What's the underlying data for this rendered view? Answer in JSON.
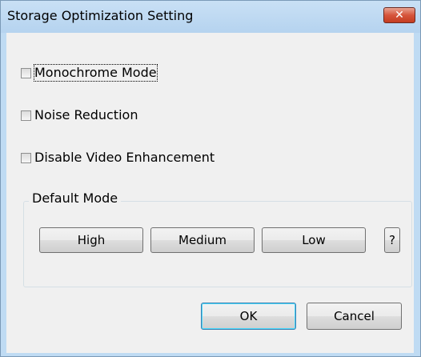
{
  "window": {
    "title": "Storage Optimization Setting",
    "close_glyph": "✕"
  },
  "options": [
    {
      "label": "Monochrome Mode",
      "checked": false,
      "focused": true
    },
    {
      "label": "Noise Reduction",
      "checked": false,
      "focused": false
    },
    {
      "label": "Disable Video Enhancement",
      "checked": false,
      "focused": false
    }
  ],
  "default_mode": {
    "group_label": "Default Mode",
    "buttons": [
      "High",
      "Medium",
      "Low"
    ],
    "help_label": "?"
  },
  "actions": {
    "ok_label": "OK",
    "cancel_label": "Cancel"
  },
  "colors": {
    "frame": "#bfdbf3",
    "client": "#f0f0f0",
    "close_button": "#c43c20"
  }
}
